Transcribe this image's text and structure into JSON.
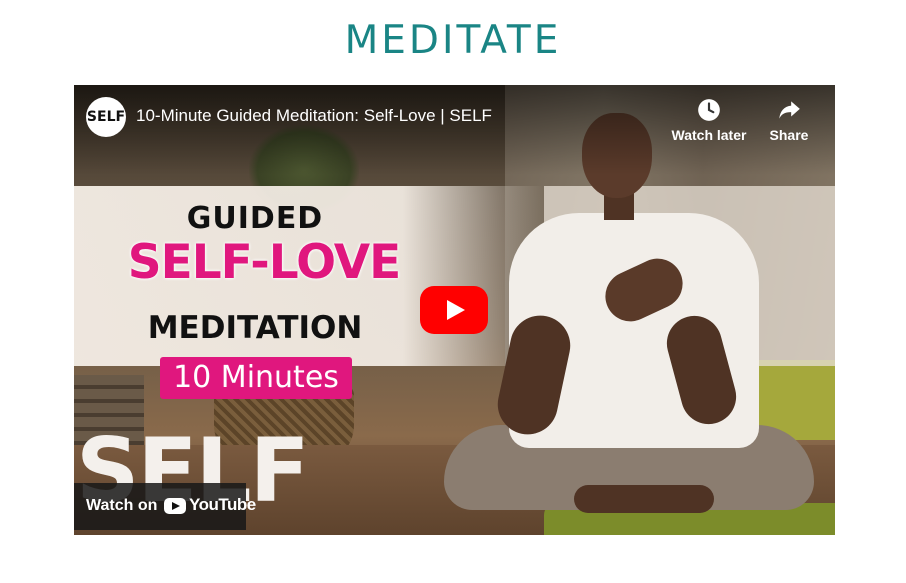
{
  "page": {
    "title": "MEDITATE"
  },
  "video": {
    "channel_avatar_text": "SELF",
    "title": "10-Minute Guided Meditation: Self-Love | SELF",
    "watch_later_label": "Watch later",
    "share_label": "Share",
    "watch_on_label": "Watch on",
    "youtube_wordmark": "YouTube"
  },
  "thumbnail": {
    "line1": "GUIDED",
    "line2": "SELF-LOVE",
    "line3": "MEDITATION",
    "badge": "10 Minutes",
    "brand": "SELF"
  },
  "colors": {
    "title": "#1a8585",
    "accent_pink": "#e0177e",
    "youtube_red": "#ff0000"
  }
}
